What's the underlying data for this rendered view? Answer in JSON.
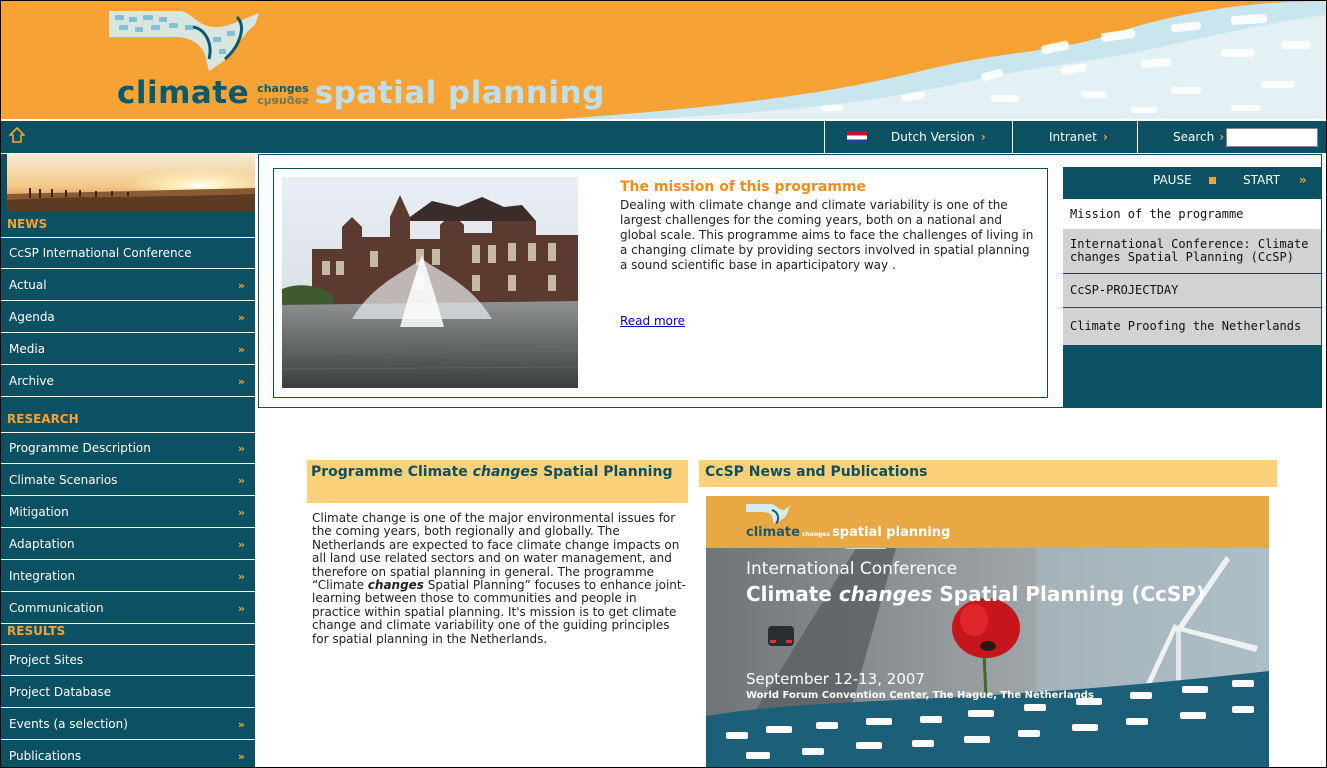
{
  "banner": {
    "brand_word1": "climate",
    "brand_word2": "changes",
    "brand_word3": "spatial planning"
  },
  "topnav": {
    "home_icon": "home-icon",
    "dutch_label": "Dutch Version",
    "intranet_label": "Intranet",
    "search_label": "Search",
    "search_value": "",
    "arrow": "›"
  },
  "leftnav": {
    "sections": [
      {
        "heading": "NEWS",
        "items": [
          {
            "label": "CcSP International Conference",
            "arrow": ""
          },
          {
            "label": "Actual",
            "arrow": "»"
          },
          {
            "label": "Agenda",
            "arrow": "»"
          },
          {
            "label": "Media",
            "arrow": "»"
          },
          {
            "label": "Archive",
            "arrow": "»"
          }
        ]
      },
      {
        "heading": "RESEARCH",
        "items": [
          {
            "label": "Programme Description",
            "arrow": "»"
          },
          {
            "label": "Climate Scenarios",
            "arrow": "»"
          },
          {
            "label": "Mitigation",
            "arrow": "»"
          },
          {
            "label": "Adaptation",
            "arrow": "»"
          },
          {
            "label": "Integration",
            "arrow": "»"
          },
          {
            "label": "Communication",
            "arrow": "»"
          }
        ]
      },
      {
        "heading": "RESULTS",
        "items": [
          {
            "label": "Project Sites",
            "arrow": ""
          },
          {
            "label": "Project Database",
            "arrow": ""
          },
          {
            "label": "Events (a selection)",
            "arrow": "»"
          },
          {
            "label": "Publications",
            "arrow": "»"
          }
        ]
      }
    ]
  },
  "feature": {
    "title": "The mission of this programme",
    "text": "Dealing with climate change and climate variability is one of the largest challenges for the coming years, both on a national and global scale. This programme aims to face the challenges of living in a changing climate by providing sectors involved in spatial planning a sound scientific base in aparticipatory way .",
    "read_more": "Read more"
  },
  "slideshow": {
    "pause": "PAUSE",
    "start": "START",
    "start_arrow": "»",
    "items": [
      {
        "label": "Mission of the programme",
        "active": true
      },
      {
        "label": "International Conference: Climate changes Spatial Planning (CcSP)",
        "active": false
      },
      {
        "label": "CcSP-PROJECTDAY",
        "active": false
      },
      {
        "label": "Climate Proofing the Netherlands",
        "active": false
      }
    ]
  },
  "programme": {
    "title_a": "Programme Climate ",
    "title_em": "changes",
    "title_b": " Spatial Planning",
    "text_a": "Climate change is one of the major environmental issues for the coming years, both regionally and globally. The Netherlands are expected to face climate change impacts on all land use related sectors and on water management, and therefore on spatial planning in general. The programme “Climate ",
    "text_em": "changes",
    "text_b": " Spatial Planning” focuses to enhance joint-learning between those to communities and people in practice within spatial planning. It's mission is to get climate change and climate variability one of the guiding principles for spatial planning in the Netherlands."
  },
  "news": {
    "title": "CcSP News and Publications",
    "poster": {
      "logo_a": "climate",
      "logo_b": "changes",
      "logo_c": "spatial planning",
      "line1": "International Conference",
      "line2_a": "Climate ",
      "line2_em": "changes",
      "line2_b": " Spatial Planning (CcSP)",
      "date": "September 12-13, 2007",
      "venue": "World Forum Convention Center, The Hague, The Netherlands"
    }
  },
  "colors": {
    "orange": "#f6a234",
    "teal": "#0b5063",
    "light_orange": "#fdd07a",
    "link": "#0000cc"
  }
}
